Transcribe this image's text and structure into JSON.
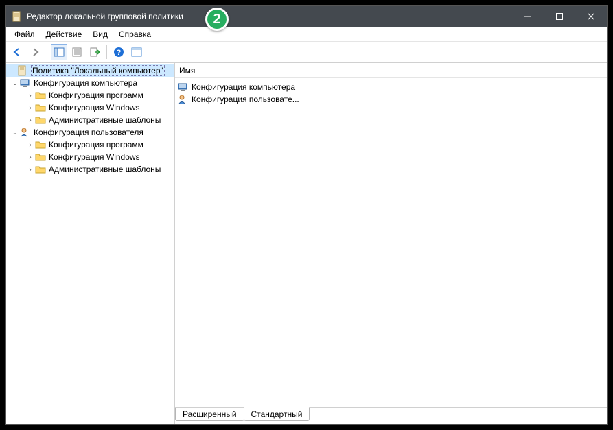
{
  "window": {
    "title": "Редактор локальной групповой политики"
  },
  "badge": {
    "number": "2"
  },
  "menu": {
    "file": "Файл",
    "action": "Действие",
    "view": "Вид",
    "help": "Справка"
  },
  "tree": {
    "root": "Политика \"Локальный компьютер\"",
    "computer": "Конфигурация компьютера",
    "comp_soft": "Конфигурация программ",
    "comp_win": "Конфигурация Windows",
    "comp_admin": "Административные шаблоны",
    "user": "Конфигурация пользователя",
    "user_soft": "Конфигурация программ",
    "user_win": "Конфигурация Windows",
    "user_admin": "Административные шаблоны"
  },
  "list": {
    "header_name": "Имя",
    "item_computer": "Конфигурация компьютера",
    "item_user": "Конфигурация пользовате..."
  },
  "tabs": {
    "extended": "Расширенный",
    "standard": "Стандартный"
  }
}
